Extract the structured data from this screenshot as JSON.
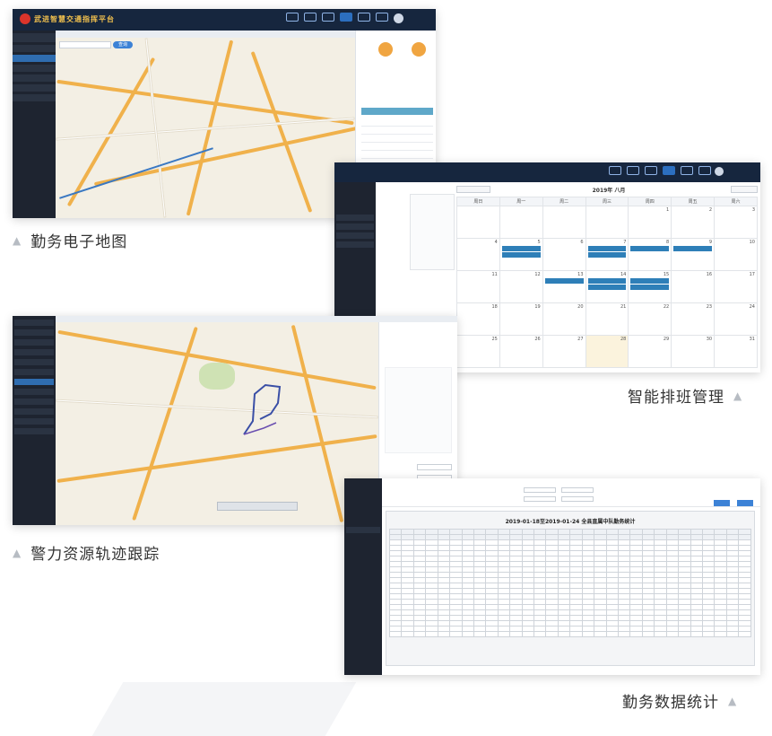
{
  "captions": {
    "map": "勤务电子地图",
    "schedule": "智能排班管理",
    "track": "警力资源轨迹跟踪",
    "stats": "勤务数据统计"
  },
  "app": {
    "brand": "武进智慧交通指挥平台"
  },
  "map_screen": {
    "search_button": "查询",
    "side_gauges": [
      "",
      ""
    ],
    "table_rows": [
      "",
      "",
      "",
      "",
      "",
      "",
      "",
      "",
      "",
      "",
      ""
    ]
  },
  "schedule_screen": {
    "month_title": "2019年 八月",
    "weekdays": [
      "周日",
      "周一",
      "周二",
      "周三",
      "周四",
      "周五",
      "周六"
    ],
    "weeks": [
      [
        "",
        "",
        "",
        "",
        "1",
        "2",
        "3"
      ],
      [
        "4",
        "5",
        "6",
        "7",
        "8",
        "9",
        "10"
      ],
      [
        "11",
        "12",
        "13",
        "14",
        "15",
        "16",
        "17"
      ],
      [
        "18",
        "19",
        "20",
        "21",
        "22",
        "23",
        "24"
      ],
      [
        "25",
        "26",
        "27",
        "28",
        "29",
        "30",
        "31"
      ]
    ]
  },
  "track_screen": {
    "buttons": [
      "",
      "",
      ""
    ]
  },
  "stats_screen": {
    "report_title": "2019-01-18至2019-01-24 全县直属中队勤务统计",
    "buttons": [
      "",
      ""
    ]
  }
}
